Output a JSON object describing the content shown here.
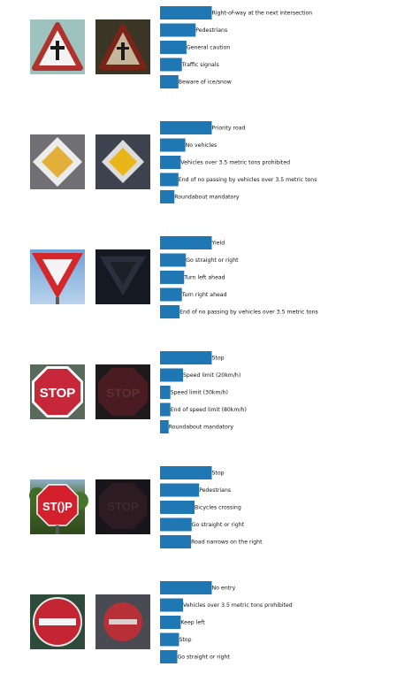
{
  "chart_data": [
    {
      "type": "bar",
      "orientation": "horizontal",
      "images": {
        "reference": "warning-triangle-crossroad-icon",
        "input": "dark-warning-triangle-icon"
      },
      "color": "#1f77b4",
      "categories": [
        "Right-of-way at the next intersection",
        "Pedestrians",
        "General caution",
        "Traffic signals",
        "Beware of ice/snow"
      ],
      "values": [
        0.9,
        0.62,
        0.46,
        0.38,
        0.32
      ]
    },
    {
      "type": "bar",
      "orientation": "horizontal",
      "images": {
        "reference": "priority-road-diamond-icon",
        "input": "priority-road-diamond-dark-icon"
      },
      "color": "#1f77b4",
      "categories": [
        "Priority road",
        "No vehicles",
        "Vehicles over 3.5 metric tons prohibited",
        "End of no passing by vehicles over 3.5 metric tons",
        "Roundabout mandatory"
      ],
      "values": [
        0.9,
        0.44,
        0.36,
        0.32,
        0.25
      ]
    },
    {
      "type": "bar",
      "orientation": "horizontal",
      "images": {
        "reference": "yield-sign-icon",
        "input": "yield-sign-dark-icon"
      },
      "color": "#1f77b4",
      "categories": [
        "Yield",
        "Go straight or right",
        "Turn left ahead",
        "Turn right ahead",
        "End of no passing by vehicles over 3.5 metric tons"
      ],
      "values": [
        0.9,
        0.45,
        0.42,
        0.38,
        0.34
      ]
    },
    {
      "type": "bar",
      "orientation": "horizontal",
      "images": {
        "reference": "stop-sign-icon",
        "input": "stop-sign-dark-icon"
      },
      "color": "#1f77b4",
      "categories": [
        "Stop",
        "Speed limit (20km/h)",
        "Speed limit (30km/h)",
        "End of speed limit (80km/h)",
        "Roundabout mandatory"
      ],
      "values": [
        0.9,
        0.4,
        0.18,
        0.18,
        0.15
      ]
    },
    {
      "type": "bar",
      "orientation": "horizontal",
      "images": {
        "reference": "stop-sign-trees-icon",
        "input": "stop-sign-dark-icon"
      },
      "color": "#1f77b4",
      "categories": [
        "Stop",
        "Pedestrians",
        "Bicycles crossing",
        "Go straight or right",
        "Road narrows on the right"
      ],
      "values": [
        0.9,
        0.68,
        0.6,
        0.55,
        0.54
      ]
    },
    {
      "type": "bar",
      "orientation": "horizontal",
      "images": {
        "reference": "no-entry-sign-icon",
        "input": "no-entry-sign-dark-icon"
      },
      "color": "#1f77b4",
      "categories": [
        "No entry",
        "Vehicles over 3.5 metric tons prohibited",
        "Keep left",
        "Stop",
        "Go straight or right"
      ],
      "values": [
        0.9,
        0.4,
        0.36,
        0.33,
        0.3
      ]
    }
  ]
}
